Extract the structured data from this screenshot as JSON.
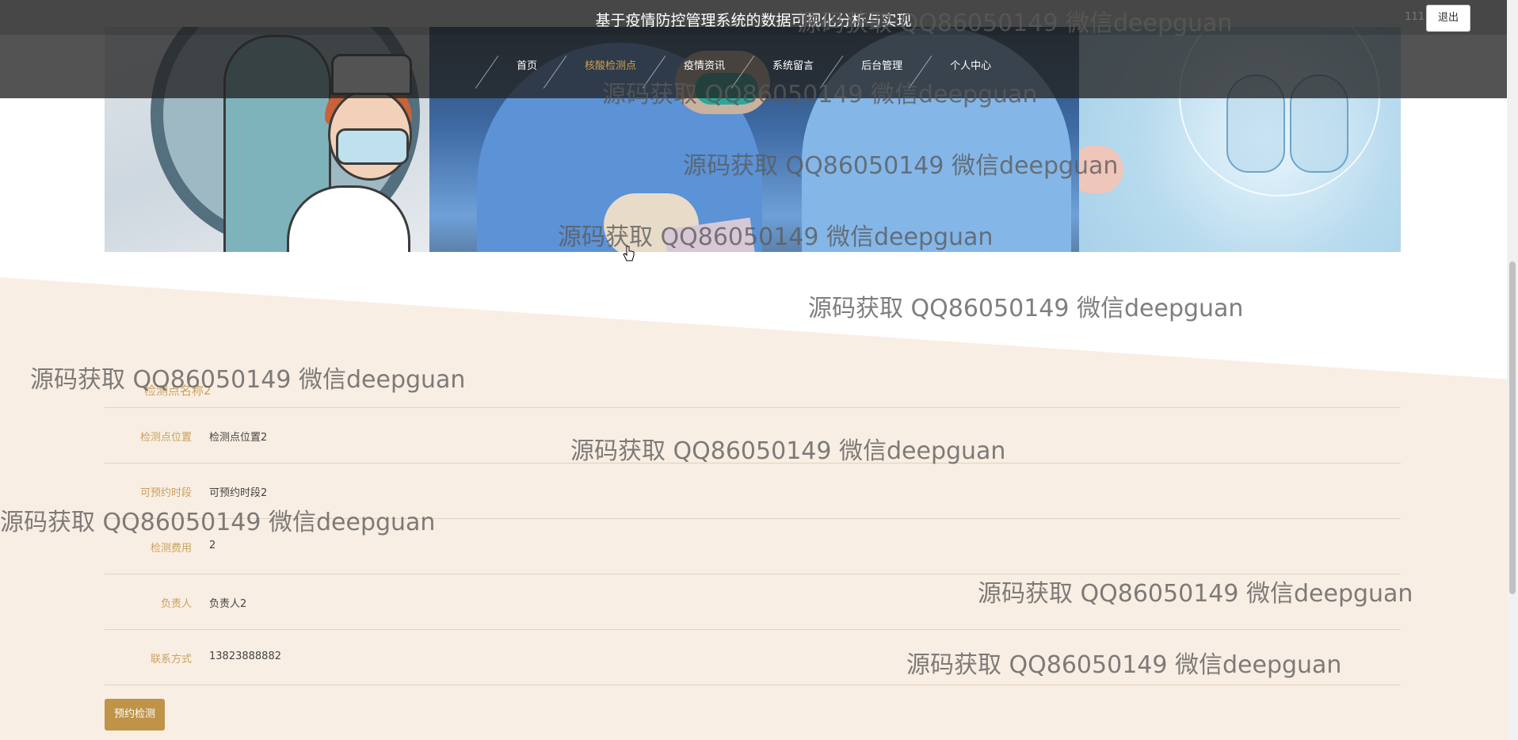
{
  "header": {
    "title": "基于疫情防控管理系统的数据可视化分析与实现",
    "user": "111",
    "logout_label": "退出"
  },
  "nav": {
    "items": [
      {
        "label": "首页",
        "active": false
      },
      {
        "label": "核酸检测点",
        "active": true
      },
      {
        "label": "疫情资讯",
        "active": false
      },
      {
        "label": "系统留言",
        "active": false
      },
      {
        "label": "后台管理",
        "active": false
      },
      {
        "label": "个人中心",
        "active": false
      }
    ]
  },
  "carousel": {
    "slide_count": 3,
    "active_index": 0
  },
  "detail": {
    "name": "检测点名称2",
    "fields": [
      {
        "label": "检测点位置",
        "value": "检测点位置2"
      },
      {
        "label": "可预约时段",
        "value": "可预约时段2"
      },
      {
        "label": "检测费用",
        "value": "2"
      },
      {
        "label": "负责人",
        "value": "负责人2"
      },
      {
        "label": "联系方式",
        "value": "13823888882"
      }
    ],
    "book_label": "预约检测"
  },
  "watermark": {
    "text": "源码获取 QQ86050149 微信deepguan"
  },
  "colors": {
    "accent": "#cf9f52",
    "label": "#c9a15f",
    "button": "#bf9348",
    "cream": "#f9eee3"
  }
}
